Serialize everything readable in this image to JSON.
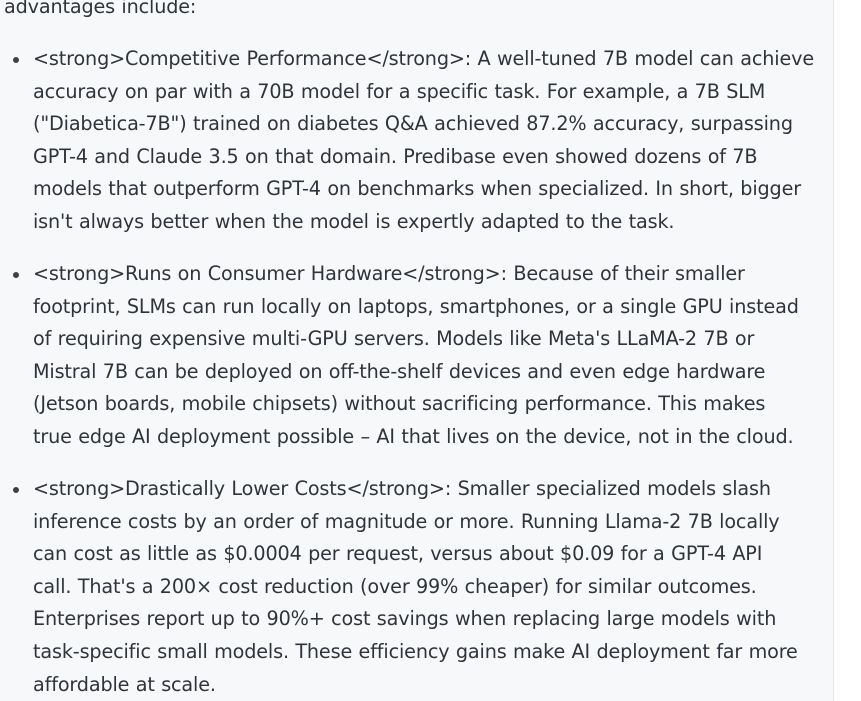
{
  "intro": "advantages include:",
  "items": [
    {
      "lines": [
        "<strong>Competitive Performance</strong>: A well-tuned 7B model can achieve",
        "accuracy on par with a 70B model for a specific task. For example, a 7B SLM",
        "(\"Diabetica-7B\") trained on diabetes Q&A achieved 87.2% accuracy, surpassing",
        "GPT-4 and Claude 3.5 on that domain. Predibase even showed dozens of 7B",
        "models that outperform GPT-4 on benchmarks when specialized. In short, bigger",
        "isn't always better when the model is expertly adapted to the task."
      ]
    },
    {
      "lines": [
        "<strong>Runs on Consumer Hardware</strong>: Because of their smaller",
        "footprint, SLMs can run locally on laptops, smartphones, or a single GPU instead",
        "of requiring expensive multi-GPU servers. Models like Meta's LLaMA-2 7B or",
        "Mistral 7B can be deployed on off-the-shelf devices and even edge hardware",
        "(Jetson boards, mobile chipsets) without sacrificing performance. This makes",
        "true edge AI deployment possible – AI that lives on the device, not in the cloud."
      ]
    },
    {
      "lines": [
        "<strong>Drastically Lower Costs</strong>: Smaller specialized models slash",
        "inference costs by an order of magnitude or more. Running Llama-2 7B locally",
        "can cost as little as $0.0004 per request, versus about $0.09 for a GPT-4 API",
        "call. That's a 200× cost reduction (over 99% cheaper) for similar outcomes.",
        "Enterprises report up to 90%+ cost savings when replacing large models with",
        "task-specific small models. These efficiency gains make AI deployment far more",
        "affordable at scale."
      ]
    }
  ]
}
